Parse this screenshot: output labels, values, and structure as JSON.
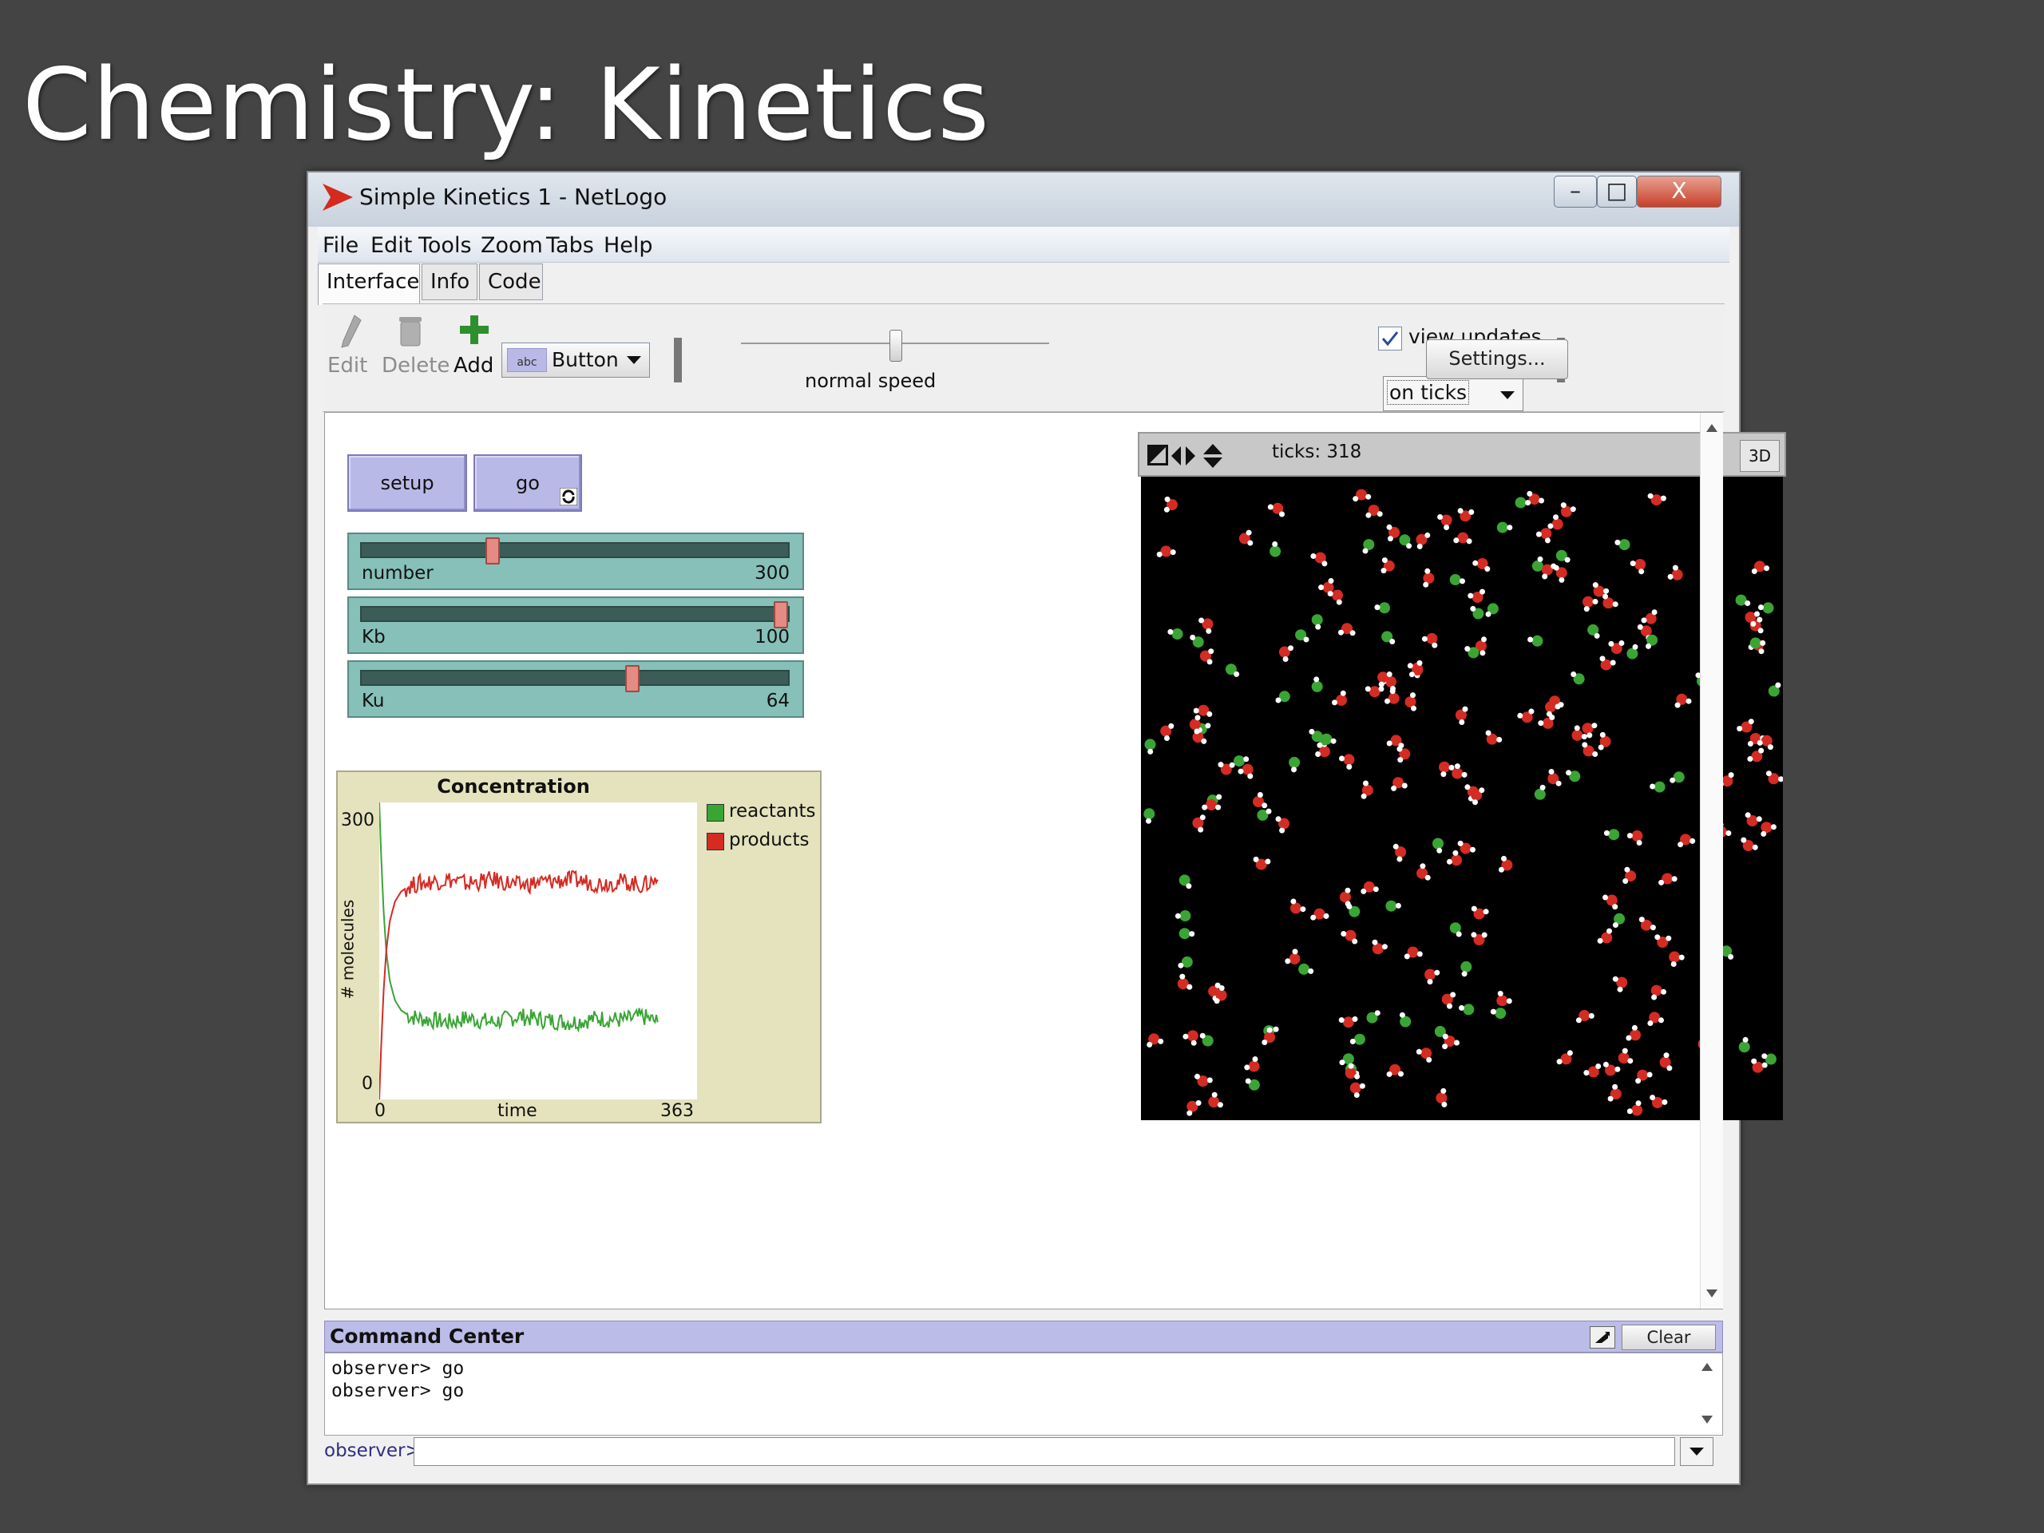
{
  "slide": {
    "title": "Chemistry: Kinetics"
  },
  "window": {
    "title": "Simple Kinetics 1 - NetLogo",
    "controls": {
      "minimize": "–",
      "maximize": "□",
      "close": "X"
    },
    "menu": [
      "File",
      "Edit",
      "Tools",
      "Zoom",
      "Tabs",
      "Help"
    ],
    "tabs": [
      "Interface",
      "Info",
      "Code"
    ],
    "active_tab": "Interface"
  },
  "toolbar": {
    "edit_label": "Edit",
    "delete_label": "Delete",
    "add_label": "Add",
    "widget_type": "Button",
    "speed_label": "normal speed",
    "speed_fraction": 0.5,
    "view_updates_label": "view updates",
    "view_updates_checked": true,
    "update_mode": "on ticks",
    "settings_label": "Settings..."
  },
  "buttons": {
    "setup": "setup",
    "go": "go"
  },
  "sliders": [
    {
      "name": "number",
      "value": "300",
      "fraction": 0.3
    },
    {
      "name": "Kb",
      "value": "100",
      "fraction": 1.0
    },
    {
      "name": "Ku",
      "value": "64",
      "fraction": 0.64
    }
  ],
  "plot": {
    "title": "Concentration",
    "y_label": "# molecules",
    "x_label": "time",
    "y_max_label": "300",
    "y_min_label": "0",
    "x_min_label": "0",
    "x_max_label": "363",
    "legend": [
      {
        "name": "reactants",
        "color": "#3aa535"
      },
      {
        "name": "products",
        "color": "#d42b23"
      }
    ]
  },
  "chart_data": {
    "type": "line",
    "title": "Concentration",
    "xlabel": "time",
    "ylabel": "# molecules",
    "xlim": [
      0,
      363
    ],
    "ylim": [
      0,
      300
    ],
    "x": [
      0,
      2,
      5,
      8,
      12,
      18,
      25,
      35,
      45,
      60,
      80,
      100,
      130,
      160,
      190,
      220,
      250,
      280,
      300,
      318
    ],
    "series": [
      {
        "name": "reactants",
        "color": "#3aa535",
        "values": [
          300,
          250,
          190,
          150,
          120,
          100,
          90,
          84,
          82,
          80,
          78,
          82,
          78,
          84,
          80,
          78,
          82,
          80,
          84,
          78
        ]
      },
      {
        "name": "products",
        "color": "#d42b23",
        "values": [
          0,
          50,
          110,
          150,
          180,
          200,
          210,
          216,
          218,
          220,
          222,
          218,
          222,
          216,
          220,
          222,
          218,
          220,
          216,
          222
        ]
      }
    ]
  },
  "view": {
    "ticks_label": "ticks: 318",
    "btn_3d": "3D",
    "colors": {
      "reactant": "#3aa535",
      "product": "#d42b23",
      "hydrogen": "#ffffff",
      "background": "#000000"
    }
  },
  "command_center": {
    "title": "Command Center",
    "clear_label": "Clear",
    "output": [
      "observer> go",
      "observer> go"
    ],
    "prompt": "observer>",
    "input_value": ""
  },
  "colors": {
    "button_fill": "#b9b9e8",
    "slider_fill": "#86c0b8",
    "plot_fill": "#e4e3bd",
    "window_bg": "#444444"
  }
}
